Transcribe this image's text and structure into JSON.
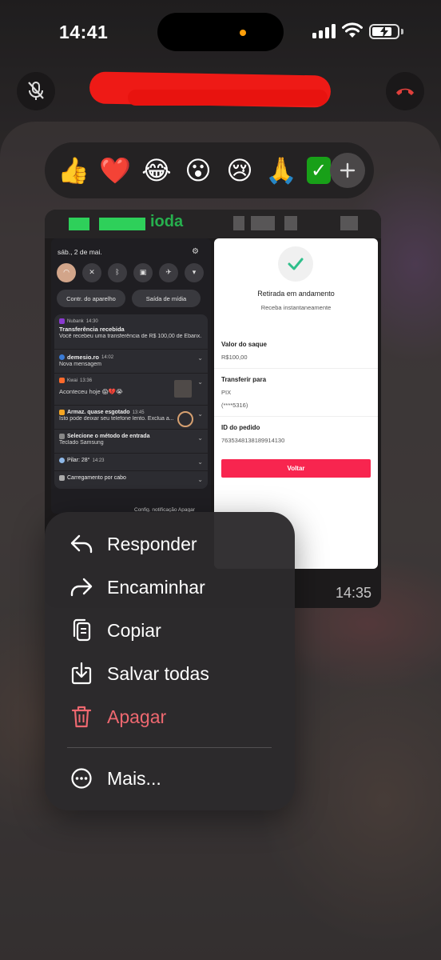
{
  "status_bar": {
    "time": "14:41"
  },
  "reactions": {
    "emojis": [
      "👍",
      "❤️",
      "😂",
      "😮",
      "😢",
      "🙏"
    ],
    "partial_emoji": "✓"
  },
  "image_message": {
    "header_text": "ioda",
    "timestamp": "14:35",
    "notifications_panel": {
      "date": "sáb., 2 de mai.",
      "buttons": [
        "Contr. do aparelho",
        "Saída de mídia"
      ],
      "notifications": [
        {
          "app": "Nubank",
          "time": "14:30",
          "title": "Transferência recebida",
          "body": "Você recebeu uma transferência de R$ 100,00 de Ebanx.",
          "color": "#8a3ad0"
        },
        {
          "app": "demesio.ro",
          "time": "14:02",
          "title": "",
          "body": "Nova mensagem",
          "color": "#3a7bd5"
        },
        {
          "app": "Kwai",
          "time": "13:36",
          "title": "",
          "body": "Aconteceu hoje 😱💔😭",
          "color": "#ff6a2b"
        },
        {
          "app": "Armaz. quase esgotado",
          "time": "13:45",
          "title": "",
          "body": "Isto pode deixar seu telefone lento. Exclua a...",
          "color": "#f5a623"
        },
        {
          "app": "Selecione o método de entrada",
          "time": "",
          "title": "",
          "body": "Teclado Samsung",
          "color": "#888888"
        },
        {
          "app": "Pilar: 28°",
          "time": "14:23",
          "title": "",
          "body": "",
          "color": "#8fb8e8"
        },
        {
          "app": "Carregamento por cabo",
          "time": "",
          "title": "",
          "body": "",
          "color": "#aaaaaa"
        }
      ],
      "footer": "Config. notificação    Apagar"
    },
    "receipt": {
      "title": "Retirada em andamento",
      "subtitle": "Receba instantaneamente",
      "fields": [
        {
          "label": "Valor do saque",
          "value": "R$100,00"
        },
        {
          "label": "Transferir para",
          "value": "PIX"
        },
        {
          "label": "",
          "value": "(****5316)"
        },
        {
          "label": "ID do pedido",
          "value": "7635348138189914130"
        }
      ],
      "button": "Voltar"
    }
  },
  "context_menu": {
    "items": [
      {
        "label": "Responder",
        "icon": "reply-icon"
      },
      {
        "label": "Encaminhar",
        "icon": "forward-icon"
      },
      {
        "label": "Copiar",
        "icon": "copy-icon"
      },
      {
        "label": "Salvar todas",
        "icon": "save-icon"
      },
      {
        "label": "Apagar",
        "icon": "trash-icon",
        "danger": true
      }
    ],
    "more": {
      "label": "Mais...",
      "icon": "more-icon"
    }
  },
  "colors": {
    "danger": "#ee6870",
    "hangup": "#e0403c",
    "receipt_accent": "#f8254f",
    "check_green": "#2fbf8b"
  }
}
